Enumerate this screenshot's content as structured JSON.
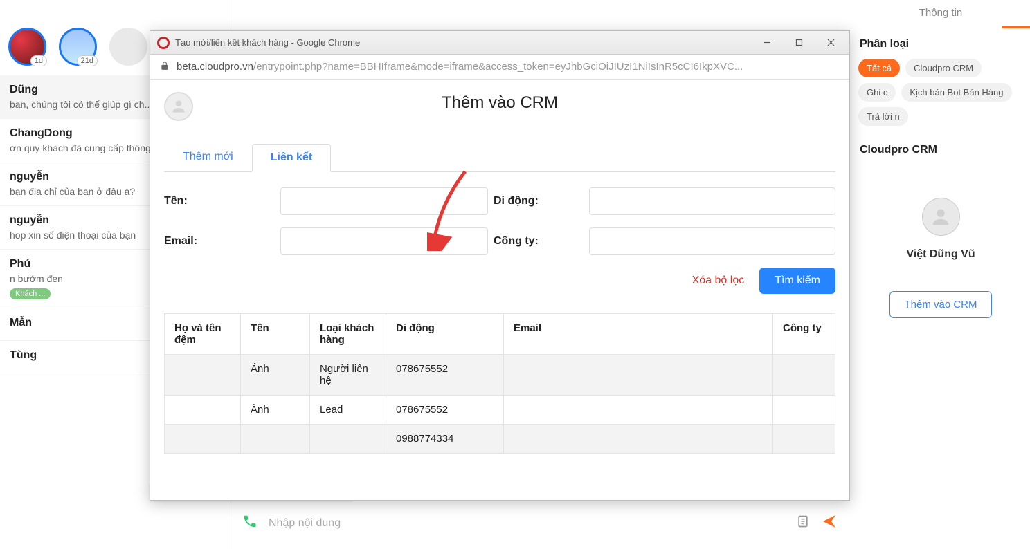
{
  "stories": {
    "badge1": "1d",
    "badge2": "21d"
  },
  "chats": [
    {
      "name": "Dũng",
      "preview": "ban, chúng tôi có thể giúp gì ch.."
    },
    {
      "name": "ChangDong",
      "preview": "ơn quý khách đã cung cấp thông.."
    },
    {
      "name": "nguyễn",
      "preview": "bạn địa chỉ của bạn ở đâu ạ?"
    },
    {
      "name": "nguyễn",
      "preview": "hop xin số điện thoại của bạn"
    },
    {
      "name": "Phú",
      "preview": "n bướm đen",
      "chip": "Khách ..."
    },
    {
      "name": "Mẫn",
      "preview": ""
    },
    {
      "name": "Tùng",
      "preview": ""
    }
  ],
  "composer": {
    "placeholder": "Nhập nội dung"
  },
  "statusbar": "https://beta.cloudpro.vn/entrypoint.php?name...",
  "right": {
    "tab": "Thông tin",
    "section1": "Phân loại",
    "tags": [
      "Tất cả",
      "Cloudpro CRM",
      "Ghi c",
      "Kịch bản Bot Bán Hàng",
      "Trả lời n"
    ],
    "section2": "Cloudpro CRM",
    "profile_name": "Việt Dũng Vũ",
    "cta": "Thêm vào CRM"
  },
  "popup": {
    "title": "Tạo mới/liên kết khách hàng - Google Chrome",
    "url_host": "beta.cloudpro.vn",
    "url_path": "/entrypoint.php?name=BBHIframe&mode=iframe&access_token=eyJhbGciOiJIUzI1NiIsInR5cCI6IkpXVC...",
    "heading": "Thêm vào CRM",
    "tab_new": "Thêm mới",
    "tab_link": "Liên kết",
    "form": {
      "name": "Tên:",
      "mobile": "Di động:",
      "email": "Email:",
      "company": "Công ty:"
    },
    "clear_filter": "Xóa bộ lọc",
    "search": "Tìm kiếm",
    "cols": [
      "Họ và tên đệm",
      "Tên",
      "Loại khách hàng",
      "Di động",
      "Email",
      "Công ty"
    ],
    "rows": [
      {
        "ho": "",
        "ten": "Ánh",
        "loai": "Người liên hệ",
        "didong": "078675552",
        "email": "",
        "cty": ""
      },
      {
        "ho": "",
        "ten": "Ánh",
        "loai": "Lead",
        "didong": "078675552",
        "email": "",
        "cty": ""
      },
      {
        "ho": "",
        "ten": "",
        "loai": "",
        "didong": "0988774334",
        "email": "",
        "cty": ""
      }
    ]
  }
}
